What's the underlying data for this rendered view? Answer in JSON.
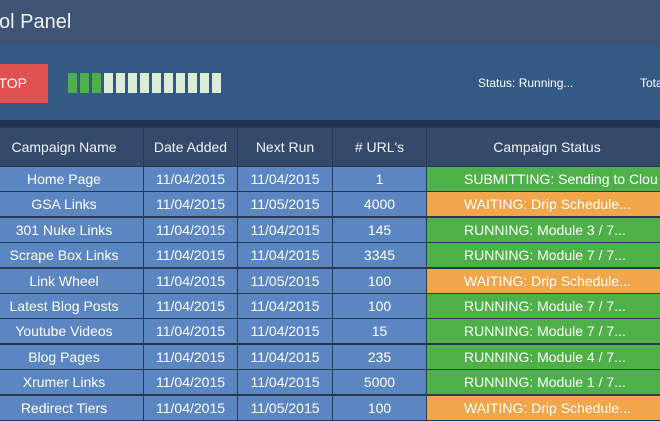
{
  "window": {
    "title": "ol Panel"
  },
  "toolbar": {
    "stop_label": "TOP",
    "progress": {
      "filled": 3,
      "total": 13
    },
    "status_label": "Status: Running...",
    "total_label": "Tota"
  },
  "table": {
    "columns": [
      "Campaign Name",
      "Date Added",
      "Next Run",
      "# URL's",
      "Campaign Status"
    ],
    "rows": [
      {
        "name": "Home Page",
        "date_added": "11/04/2015",
        "next_run": "11/04/2015",
        "urls": "1",
        "status": "SUBMITTING: Sending to Clou",
        "status_color": "green"
      },
      {
        "name": "GSA Links",
        "date_added": "11/04/2015",
        "next_run": "11/05/2015",
        "urls": "4000",
        "status": "WAITING: Drip Schedule...",
        "status_color": "orange"
      },
      {
        "name": "301 Nuke Links",
        "date_added": "11/04/2015",
        "next_run": "11/04/2015",
        "urls": "145",
        "status": "RUNNING: Module 3 / 7...",
        "status_color": "green"
      },
      {
        "name": "Scrape Box Links",
        "date_added": "11/04/2015",
        "next_run": "11/04/2015",
        "urls": "3345",
        "status": "RUNNING: Module 7 / 7...",
        "status_color": "green"
      },
      {
        "name": "Link Wheel",
        "date_added": "11/04/2015",
        "next_run": "11/05/2015",
        "urls": "100",
        "status": "WAITING: Drip Schedule...",
        "status_color": "orange"
      },
      {
        "name": "Latest Blog Posts",
        "date_added": "11/04/2015",
        "next_run": "11/04/2015",
        "urls": "100",
        "status": "RUNNING: Module 7 / 7...",
        "status_color": "green"
      },
      {
        "name": "Youtube Videos",
        "date_added": "11/04/2015",
        "next_run": "11/04/2015",
        "urls": "15",
        "status": "RUNNING: Module 7 / 7...",
        "status_color": "green"
      },
      {
        "name": "Blog Pages",
        "date_added": "11/04/2015",
        "next_run": "11/04/2015",
        "urls": "235",
        "status": "RUNNING: Module 4 / 7...",
        "status_color": "green"
      },
      {
        "name": "Xrumer Links",
        "date_added": "11/04/2015",
        "next_run": "11/04/2015",
        "urls": "5000",
        "status": "RUNNING: Module 1 / 7...",
        "status_color": "green"
      },
      {
        "name": "Redirect Tiers",
        "date_added": "11/04/2015",
        "next_run": "11/05/2015",
        "urls": "100",
        "status": "WAITING: Drip Schedule...",
        "status_color": "orange"
      }
    ]
  },
  "colors": {
    "green": "#4fb04a",
    "orange": "#f2a64a",
    "stop": "#e05252",
    "cell": "#5b86c2"
  }
}
